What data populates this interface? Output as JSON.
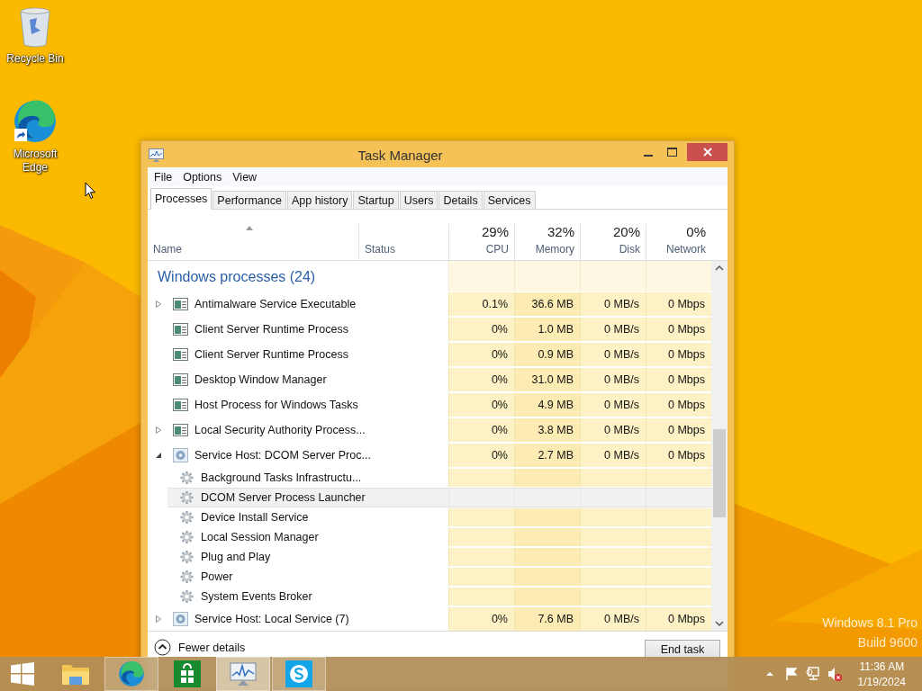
{
  "desktop": {
    "icons": [
      {
        "label": "Recycle Bin",
        "kind": "recycle-bin"
      },
      {
        "label": "Microsoft Edge",
        "kind": "edge"
      }
    ],
    "edition": "Windows 8.1 Pro",
    "build": "Build 9600"
  },
  "window": {
    "title": "Task Manager",
    "menu": [
      "File",
      "Options",
      "View"
    ],
    "tabs": [
      {
        "label": "Processes",
        "selected": true
      },
      {
        "label": "Performance",
        "selected": false
      },
      {
        "label": "App history",
        "selected": false
      },
      {
        "label": "Startup",
        "selected": false
      },
      {
        "label": "Users",
        "selected": false
      },
      {
        "label": "Details",
        "selected": false
      },
      {
        "label": "Services",
        "selected": false
      }
    ],
    "columns": [
      {
        "label": "Name"
      },
      {
        "label": "Status"
      },
      {
        "label": "CPU",
        "total": "29%"
      },
      {
        "label": "Memory",
        "total": "32%"
      },
      {
        "label": "Disk",
        "total": "20%"
      },
      {
        "label": "Network",
        "total": "0%"
      }
    ],
    "group": {
      "title": "Windows processes (24)",
      "rows": [
        {
          "name": "Antimalware Service Executable",
          "kind": "app",
          "expanded": false,
          "selected": false,
          "cpu": "0.1%",
          "memory": "36.6 MB",
          "disk": "0 MB/s",
          "network": "0 Mbps"
        },
        {
          "name": "Client Server Runtime Process",
          "kind": "app",
          "selected": false,
          "cpu": "0%",
          "memory": "1.0 MB",
          "disk": "0 MB/s",
          "network": "0 Mbps"
        },
        {
          "name": "Client Server Runtime Process",
          "kind": "app",
          "selected": false,
          "cpu": "0%",
          "memory": "0.9 MB",
          "disk": "0 MB/s",
          "network": "0 Mbps"
        },
        {
          "name": "Desktop Window Manager",
          "kind": "app",
          "selected": false,
          "cpu": "0%",
          "memory": "31.0 MB",
          "disk": "0 MB/s",
          "network": "0 Mbps"
        },
        {
          "name": "Host Process for Windows Tasks",
          "kind": "app",
          "selected": false,
          "cpu": "0%",
          "memory": "4.9 MB",
          "disk": "0 MB/s",
          "network": "0 Mbps"
        },
        {
          "name": "Local Security Authority Process...",
          "kind": "app",
          "expanded": false,
          "selected": false,
          "cpu": "0%",
          "memory": "3.8 MB",
          "disk": "0 MB/s",
          "network": "0 Mbps"
        },
        {
          "name": "Service Host: DCOM Server Proc...",
          "kind": "service",
          "expanded": true,
          "selected": false,
          "cpu": "0%",
          "memory": "2.7 MB",
          "disk": "0 MB/s",
          "network": "0 Mbps",
          "children": [
            {
              "name": "Background Tasks Infrastructu...",
              "selected": false
            },
            {
              "name": "DCOM Server Process Launcher",
              "selected": true
            },
            {
              "name": "Device Install Service",
              "selected": false
            },
            {
              "name": "Local Session Manager",
              "selected": false
            },
            {
              "name": "Plug and Play",
              "selected": false
            },
            {
              "name": "Power",
              "selected": false
            },
            {
              "name": "System Events Broker",
              "selected": false
            }
          ]
        },
        {
          "name": "Service Host: Local Service (7)",
          "kind": "service",
          "expanded": false,
          "selected": false,
          "cpu": "0%",
          "memory": "7.6 MB",
          "disk": "0 MB/s",
          "network": "0 Mbps"
        }
      ]
    },
    "footer": {
      "details_toggle": "Fewer details",
      "end_task": "End task"
    }
  },
  "taskbar": {
    "apps": [
      {
        "kind": "explorer",
        "running": false,
        "active": false
      },
      {
        "kind": "edge",
        "running": true,
        "active": false
      },
      {
        "kind": "store",
        "running": false,
        "active": false
      },
      {
        "kind": "task-manager",
        "running": true,
        "active": true
      },
      {
        "kind": "skype",
        "running": true,
        "active": false
      }
    ],
    "clock": {
      "time": "11:36 AM",
      "date": "1/19/2024"
    }
  }
}
